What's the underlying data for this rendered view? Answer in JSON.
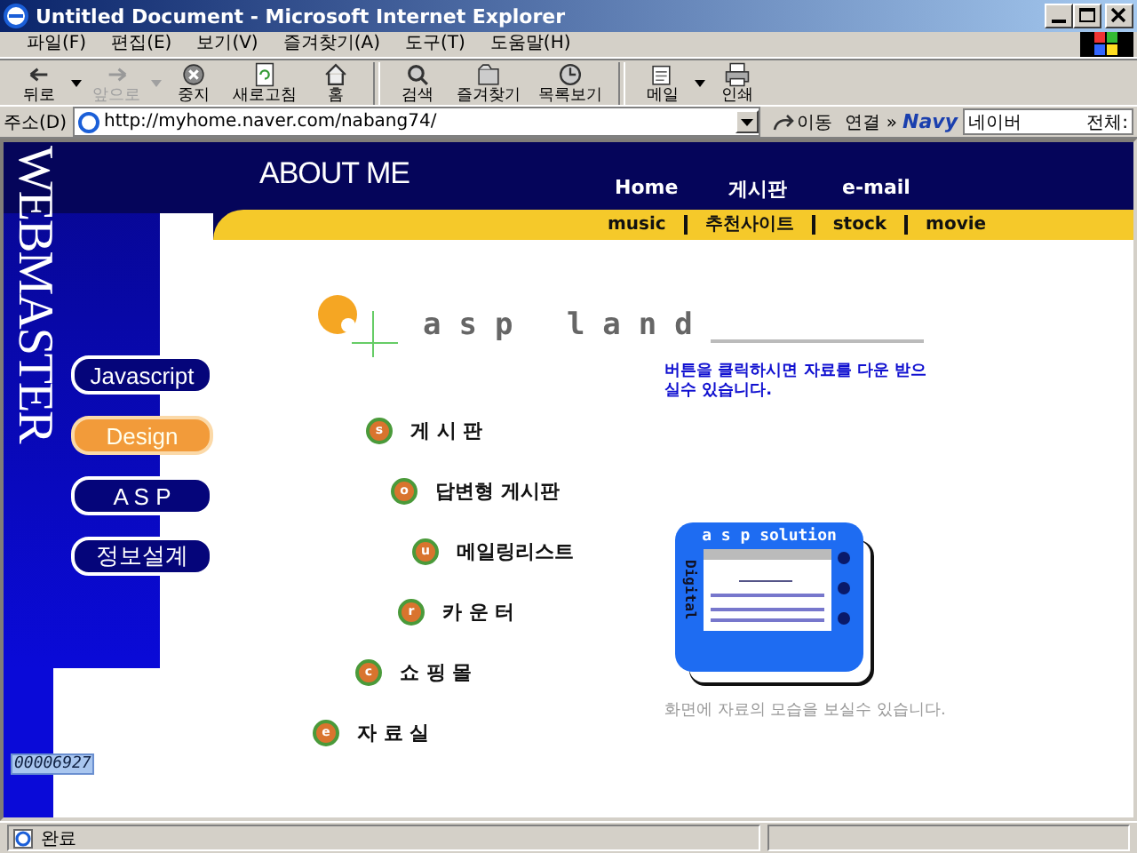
{
  "window": {
    "title": "Untitled Document - Microsoft Internet Explorer"
  },
  "menu": [
    "파일(F)",
    "편집(E)",
    "보기(V)",
    "즐겨찾기(A)",
    "도구(T)",
    "도움말(H)"
  ],
  "toolbar": [
    {
      "kind": "back",
      "label": "뒤로",
      "disabled": false,
      "dropdown": true
    },
    {
      "kind": "forward",
      "label": "앞으로",
      "disabled": true,
      "dropdown": true
    },
    {
      "kind": "stop",
      "label": "중지",
      "disabled": false,
      "dropdown": false
    },
    {
      "kind": "refresh",
      "label": "새로고침",
      "disabled": false,
      "dropdown": false
    },
    {
      "kind": "home",
      "label": "홈",
      "disabled": false,
      "dropdown": false
    },
    {
      "kind": "search",
      "label": "검색",
      "disabled": false,
      "dropdown": false
    },
    {
      "kind": "favorites",
      "label": "즐겨찾기",
      "disabled": false,
      "dropdown": false
    },
    {
      "kind": "history",
      "label": "목록보기",
      "disabled": false,
      "dropdown": false
    },
    {
      "kind": "mail",
      "label": "메일",
      "disabled": false,
      "dropdown": true
    },
    {
      "kind": "print",
      "label": "인쇄",
      "disabled": false,
      "dropdown": false
    }
  ],
  "address": {
    "label": "주소(D)",
    "value": "http://myhome.naver.com/nabang74/",
    "go": "이동",
    "links": "연결 »",
    "search_logo": "Navy",
    "search_value": "네이버",
    "search_scope": "전체:"
  },
  "page": {
    "logo": "WEBMASTER",
    "header": "ABOUT ME",
    "nav": [
      "Home",
      "게시판",
      "e-mail"
    ],
    "subnav": [
      "music",
      "추천사이트",
      "stock",
      "movie"
    ],
    "side_buttons": [
      {
        "label": "Javascript",
        "selected": false
      },
      {
        "label": "Design",
        "selected": true
      },
      {
        "label": "A S P",
        "selected": false
      },
      {
        "label": "정보설계",
        "selected": false
      }
    ],
    "counter": "00006927",
    "title": "asp land",
    "links": [
      {
        "bullet": "s",
        "label": "게 시 판"
      },
      {
        "bullet": "o",
        "label": "답변형 게시판"
      },
      {
        "bullet": "u",
        "label": "메일링리스트"
      },
      {
        "bullet": "r",
        "label": "카 운 터"
      },
      {
        "bullet": "c",
        "label": "쇼 핑 몰"
      },
      {
        "bullet": "e",
        "label": "자 료 실"
      }
    ],
    "notice": "버튼을 클릭하시면 자료를 다운 받으실수 있습니다.",
    "device_title": "a s p solution",
    "device_side": "Digital",
    "caption": "화면에 자료의 모습을 보실수 있습니다."
  },
  "status": {
    "text": "완료"
  }
}
